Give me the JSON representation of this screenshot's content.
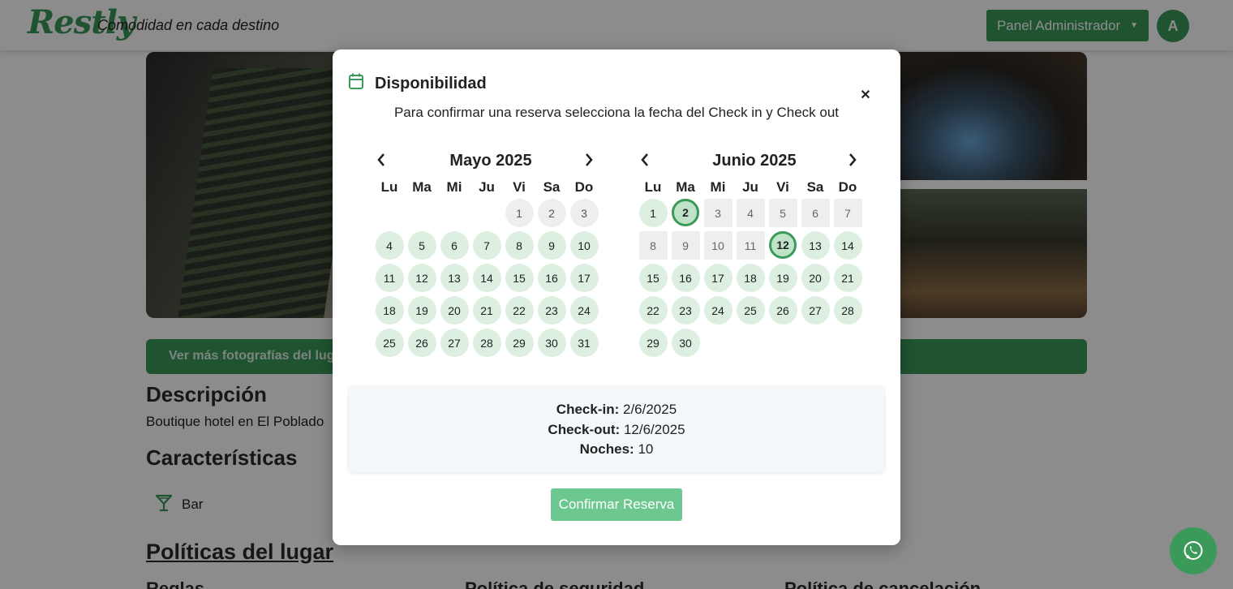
{
  "header": {
    "logo": "Restly",
    "slogan": "Comodidad en cada destino",
    "admin_button": "Panel Administrador",
    "avatar_initial": "A"
  },
  "page": {
    "more_photos_button": "Ver más fotografías del lugar",
    "description_title": "Descripción",
    "description_text": "Boutique hotel en El Poblado",
    "characteristics_title": "Características",
    "features": [
      {
        "label": "Bar",
        "icon": "cocktail-glass-icon"
      }
    ],
    "policies_title": "Políticas del lugar",
    "policy_sections": [
      "Reglas",
      "Política de seguridad",
      "Política de cancelación"
    ]
  },
  "modal": {
    "title": "Disponibilidad",
    "subtitle": "Para confirmar una reserva selecciona la fecha del Check in y Check out",
    "weekdays": [
      "Lu",
      "Ma",
      "Mi",
      "Ju",
      "Vi",
      "Sa",
      "Do"
    ],
    "months": [
      {
        "title": "Mayo 2025",
        "offset": 4,
        "days": 31,
        "past_days": [
          1,
          2,
          3
        ],
        "unavailable_days": [],
        "selected_days": []
      },
      {
        "title": "Junio 2025",
        "offset": 0,
        "days": 30,
        "past_days": [],
        "unavailable_days": [
          3,
          4,
          5,
          6,
          7,
          8,
          9,
          10,
          11
        ],
        "selected_days": [
          2,
          12
        ]
      }
    ],
    "summary": {
      "checkin_label": "Check-in:",
      "checkin_value": "2/6/2025",
      "checkout_label": "Check-out:",
      "checkout_value": "12/6/2025",
      "nights_label": "Noches:",
      "nights_value": "10"
    },
    "confirm_button": "Confirmar Reserva"
  },
  "colors": {
    "brand_green": "#3b9a5a",
    "available_day": "#dcefe0",
    "unavailable_day": "#eeeeee",
    "confirm_button": "#6cc88e"
  }
}
